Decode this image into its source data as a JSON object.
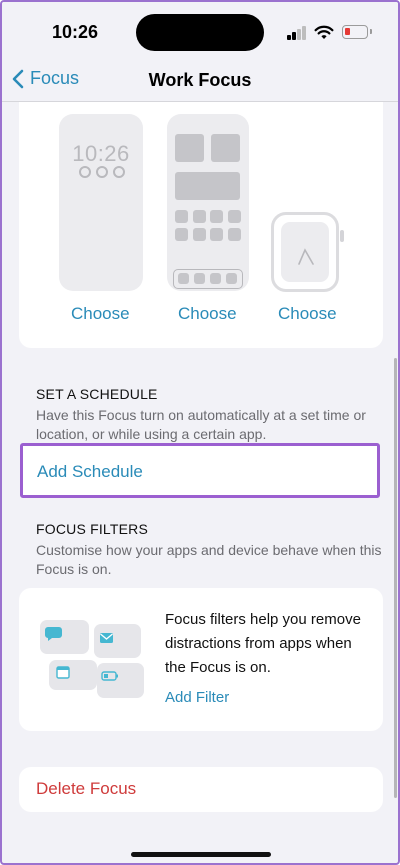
{
  "status_bar": {
    "time": "10:26"
  },
  "nav": {
    "back_label": "Focus",
    "title": "Work Focus"
  },
  "screens": {
    "lock_time": "10:26",
    "choose_labels": [
      "Choose",
      "Choose",
      "Choose"
    ]
  },
  "schedule": {
    "header": "SET A SCHEDULE",
    "description": "Have this Focus turn on automatically at a set time or location, or while using a certain app.",
    "add_label": "Add Schedule"
  },
  "filters": {
    "header": "FOCUS FILTERS",
    "description": "Customise how your apps and device behave when this Focus is on.",
    "card_text": "Focus filters help you remove distractions from apps when the Focus is on.",
    "add_label": "Add Filter",
    "icons": [
      "message-icon",
      "mail-icon",
      "calendar-icon",
      "battery-icon"
    ]
  },
  "delete": {
    "label": "Delete Focus"
  },
  "colors": {
    "accent": "#2a8bb8",
    "destructive": "#cf3b3b",
    "highlight": "#9b5fd0",
    "icon_teal": "#45b7d1"
  }
}
